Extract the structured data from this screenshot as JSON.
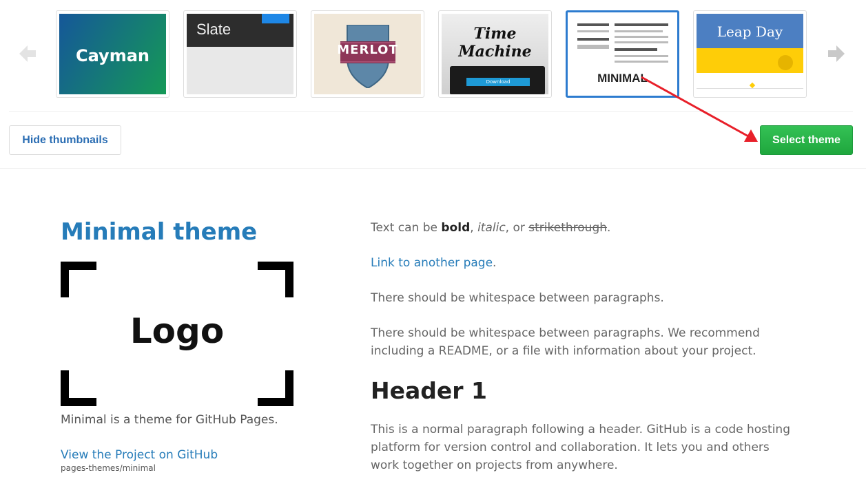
{
  "chooser": {
    "themes": [
      {
        "name": "Cayman",
        "selected": false
      },
      {
        "name": "Slate",
        "selected": false
      },
      {
        "name": "MERLOT",
        "selected": false
      },
      {
        "name_line1": "Time",
        "name_line2": "Machine",
        "button": "Download",
        "selected": false
      },
      {
        "name": "MINIMAL",
        "selected": true
      },
      {
        "name": "Leap Day",
        "selected": false
      }
    ],
    "hide_thumbnails_label": "Hide thumbnails",
    "select_theme_label": "Select theme",
    "colors": {
      "accent": "#2c7bcf",
      "select_green": "#2ea44f",
      "arrow_red": "#e8202a"
    }
  },
  "preview": {
    "title": "Minimal theme",
    "logo_text": "Logo",
    "tagline": "Minimal is a theme for GitHub Pages.",
    "project_link": "View the Project on GitHub",
    "project_sub": "pages-themes/minimal",
    "p1_prefix": "Text can be ",
    "p1_bold": "bold",
    "p1_sep1": ", ",
    "p1_italic": "italic",
    "p1_sep2": ", or ",
    "p1_strike": "strikethrough",
    "p1_end": ".",
    "link_text": "Link to another page",
    "link_end": ".",
    "p3": "There should be whitespace between paragraphs.",
    "p4": "There should be whitespace between paragraphs. We recommend including a README, or a file with information about your project.",
    "header1": "Header 1",
    "p5": "This is a normal paragraph following a header. GitHub is a code hosting platform for version control and collaboration. It lets you and others work together on projects from anywhere."
  }
}
